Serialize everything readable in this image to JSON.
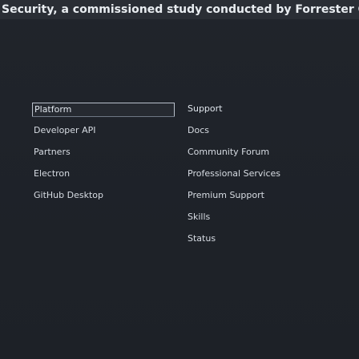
{
  "banner": {
    "text": "Security, a commissioned study conducted by Forrester Consult"
  },
  "nav": {
    "left": {
      "heading": "Platform",
      "items": [
        {
          "label": "Developer API"
        },
        {
          "label": "Partners"
        },
        {
          "label": "Electron"
        },
        {
          "label": "GitHub Desktop"
        }
      ]
    },
    "right": {
      "heading": "Support",
      "items": [
        {
          "label": "Docs"
        },
        {
          "label": "Community Forum"
        },
        {
          "label": "Professional Services"
        },
        {
          "label": "Premium Support"
        },
        {
          "label": "Skills"
        },
        {
          "label": "Status"
        }
      ]
    }
  }
}
